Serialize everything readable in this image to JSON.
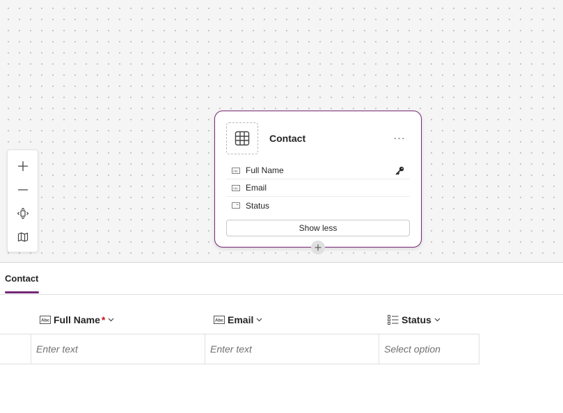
{
  "canvas": {
    "zoom_controls": {
      "zoom_in_icon": "plus-icon",
      "zoom_out_icon": "minus-icon",
      "fit_icon": "fit-view-icon",
      "minimap_icon": "map-icon"
    },
    "card": {
      "title": "Contact",
      "more_label": "···",
      "fields": [
        {
          "label": "Full Name",
          "icon": "text-field-icon",
          "primary_key": true
        },
        {
          "label": "Email",
          "icon": "text-field-icon",
          "primary_key": false
        },
        {
          "label": "Status",
          "icon": "choice-field-icon",
          "primary_key": false
        }
      ],
      "show_less_label": "Show less"
    }
  },
  "panel": {
    "tab_label": "Contact",
    "columns": [
      {
        "label": "Full Name",
        "required_mark": "*",
        "icon": "text-field-icon"
      },
      {
        "label": "Email",
        "icon": "text-field-icon"
      },
      {
        "label": "Status",
        "icon": "choice-list-icon"
      }
    ],
    "row": {
      "full_name_placeholder": "Enter text",
      "email_placeholder": "Enter text",
      "status_placeholder": "Select option"
    }
  },
  "colors": {
    "accent": "#742774",
    "required": "#c50f1f"
  }
}
